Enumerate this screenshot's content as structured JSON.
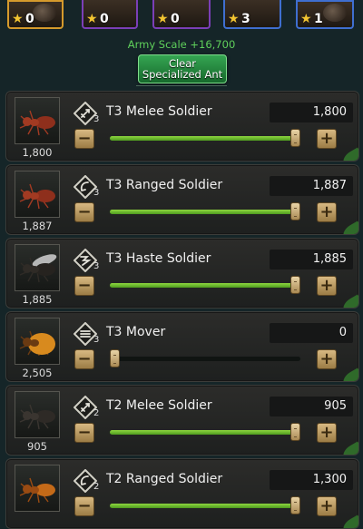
{
  "squads": [
    {
      "count": "0",
      "style": "highlight"
    },
    {
      "count": "0",
      "style": "purple"
    },
    {
      "count": "0",
      "style": "purple"
    },
    {
      "count": "3",
      "style": "blue"
    },
    {
      "count": "1",
      "style": "highlight"
    }
  ],
  "header": {
    "army_scale": "Army Scale +16,700",
    "clear_line1": "Clear",
    "clear_line2": "Specialized Ant"
  },
  "rows": [
    {
      "name": "T3 Melee Soldier",
      "tier": "3",
      "owned": "1,800",
      "quantity": "1,800",
      "level": 1.0,
      "icon": "melee-icon",
      "ant": "red-ant",
      "minus": "−",
      "plus": "+"
    },
    {
      "name": "T3 Ranged Soldier",
      "tier": "3",
      "owned": "1,887",
      "quantity": "1,887",
      "level": 1.0,
      "icon": "ranged-icon",
      "ant": "red-ant",
      "minus": "−",
      "plus": "+"
    },
    {
      "name": "T3 Haste Soldier",
      "tier": "3",
      "owned": "1,885",
      "quantity": "1,885",
      "level": 1.0,
      "icon": "haste-icon",
      "ant": "winged-ant",
      "minus": "−",
      "plus": "+"
    },
    {
      "name": "T3 Mover",
      "tier": "3",
      "owned": "2,505",
      "quantity": "0",
      "level": 0.0,
      "icon": "mover-icon",
      "ant": "honey-ant",
      "minus": "−",
      "plus": "+"
    },
    {
      "name": "T2 Melee Soldier",
      "tier": "2",
      "owned": "905",
      "quantity": "905",
      "level": 1.0,
      "icon": "melee-icon",
      "ant": "black-ant",
      "minus": "−",
      "plus": "+"
    },
    {
      "name": "T2 Ranged Soldier",
      "tier": "2",
      "owned": "",
      "quantity": "1,300",
      "level": 1.0,
      "icon": "ranged-icon",
      "ant": "orange-ant",
      "minus": "−",
      "plus": "+"
    }
  ],
  "colors": {
    "accent_green": "#5fd05b",
    "slider_fill": "#7ec93a",
    "button_gold": "#c9a86b"
  },
  "icons": {
    "star": "★"
  }
}
